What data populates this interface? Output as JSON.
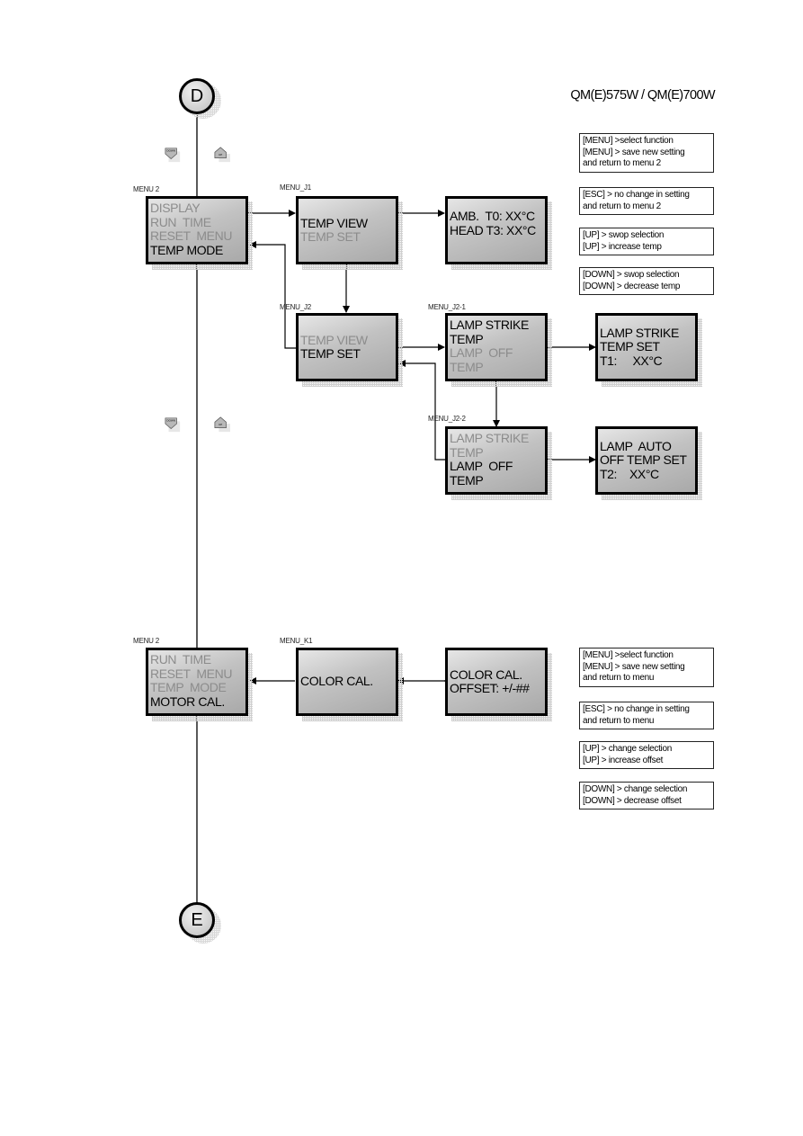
{
  "header": {
    "title": "QM(E)575W / QM(E)700W"
  },
  "connectors": {
    "start": "D",
    "end": "E"
  },
  "keys": {
    "down": "DOWN",
    "up": "UP",
    "down_icon": "down-key-icon",
    "up_icon": "up-key-icon"
  },
  "section_j": {
    "menu2": {
      "label": "MENU 2",
      "lines": [
        {
          "text": "DISPLAY",
          "selected": false
        },
        {
          "text": "RUN  TIME",
          "selected": false
        },
        {
          "text": "RESET  MENU",
          "selected": false
        },
        {
          "text": "TEMP MODE",
          "selected": true
        }
      ]
    },
    "menu_j1": {
      "label": "MENU_J1",
      "lines": [
        {
          "text": "TEMP VIEW",
          "selected": true
        },
        {
          "text": "TEMP SET",
          "selected": false
        }
      ]
    },
    "temp_view_display": {
      "lines": [
        {
          "text": "AMB.  T0: XX°C",
          "selected": true
        },
        {
          "text": "HEAD T3: XX°C",
          "selected": true
        }
      ]
    },
    "menu_j2": {
      "label": "MENU_J2",
      "lines": [
        {
          "text": "TEMP VIEW",
          "selected": false
        },
        {
          "text": "TEMP SET",
          "selected": true
        }
      ]
    },
    "menu_j2_1": {
      "label": "MENU_J2-1",
      "lines": [
        {
          "text": "LAMP STRIKE",
          "selected": true
        },
        {
          "text": "TEMP",
          "selected": true
        },
        {
          "text": "LAMP  OFF",
          "selected": false
        },
        {
          "text": "TEMP",
          "selected": false
        }
      ]
    },
    "strike_set_display": {
      "lines": [
        {
          "text": "LAMP STRIKE",
          "selected": true
        },
        {
          "text": "TEMP SET",
          "selected": true
        },
        {
          "text": "T1:     XX°C",
          "selected": true
        }
      ]
    },
    "menu_j2_2": {
      "label": "MENU_J2-2",
      "lines": [
        {
          "text": "LAMP STRIKE",
          "selected": false
        },
        {
          "text": "TEMP",
          "selected": false
        },
        {
          "text": "LAMP  OFF",
          "selected": true
        },
        {
          "text": "TEMP",
          "selected": true
        }
      ]
    },
    "auto_off_set_display": {
      "lines": [
        {
          "text": "LAMP  AUTO",
          "selected": true
        },
        {
          "text": "OFF TEMP SET",
          "selected": true
        },
        {
          "text": "T2:    XX°C",
          "selected": true
        }
      ]
    },
    "notes": [
      {
        "lines": [
          "[MENU] >select function",
          "[MENU] > save new setting",
          "and return to menu 2"
        ]
      },
      {
        "lines": [
          "[ESC] > no change in setting",
          "and return to menu 2"
        ]
      },
      {
        "lines": [
          "[UP] > swop selection",
          "[UP] > increase temp"
        ]
      },
      {
        "lines": [
          "[DOWN] > swop selection",
          "[DOWN] > decrease temp"
        ]
      }
    ]
  },
  "section_k": {
    "menu2": {
      "label": "MENU 2",
      "lines": [
        {
          "text": "RUN  TIME",
          "selected": false
        },
        {
          "text": "RESET  MENU",
          "selected": false
        },
        {
          "text": "TEMP  MODE",
          "selected": false
        },
        {
          "text": "MOTOR CAL.",
          "selected": true
        }
      ]
    },
    "menu_k1": {
      "label": "MENU_K1",
      "lines": [
        {
          "text": "COLOR CAL.",
          "selected": true
        }
      ]
    },
    "color_offset_display": {
      "lines": [
        {
          "text": "COLOR CAL.",
          "selected": true
        },
        {
          "text": "OFFSET: +/-##",
          "selected": true
        }
      ]
    },
    "notes": [
      {
        "lines": [
          "[MENU] >select function",
          "[MENU] > save new setting",
          "and return to menu"
        ]
      },
      {
        "lines": [
          "[ESC] > no change in setting",
          "and return to menu"
        ]
      },
      {
        "lines": [
          "[UP] > change selection",
          "[UP] > increase offset"
        ]
      },
      {
        "lines": [
          "[DOWN] > change selection",
          "[DOWN] > decrease offset"
        ]
      }
    ]
  }
}
